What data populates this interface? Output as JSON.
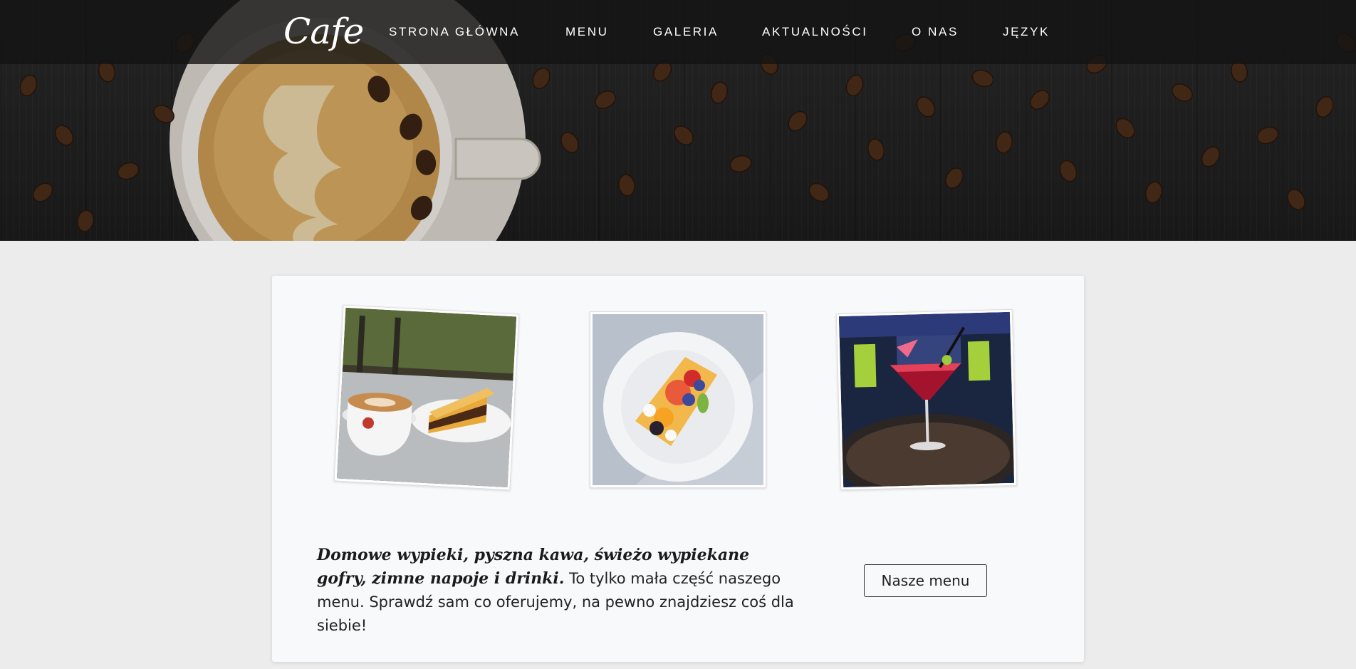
{
  "nav": {
    "brand": "Cafe",
    "items": [
      {
        "label": "STRONA GŁÓWNA"
      },
      {
        "label": "MENU"
      },
      {
        "label": "GALERIA"
      },
      {
        "label": "AKTUALNOŚCI"
      },
      {
        "label": "O NAS"
      },
      {
        "label": "JĘZYK"
      }
    ]
  },
  "gallery": {
    "photos": [
      {
        "subject": "coffee-and-cake"
      },
      {
        "subject": "fruit-tart"
      },
      {
        "subject": "cocktail"
      }
    ]
  },
  "intro": {
    "lead": "Domowe wypieki, pyszna kawa, świeżo wypiekane gofry, zimne napoje i drinki.",
    "text": " To tylko mała część naszego menu. Sprawdź sam co oferujemy, na pewno znajdziesz coś dla siebie!"
  },
  "cta": {
    "label": "Nasze menu"
  },
  "colors": {
    "nav_bg": "#121212",
    "hero_dark": "#1c1c1c",
    "card_bg": "#f8f9fb",
    "page_bg": "#ececec",
    "text": "#222222"
  }
}
